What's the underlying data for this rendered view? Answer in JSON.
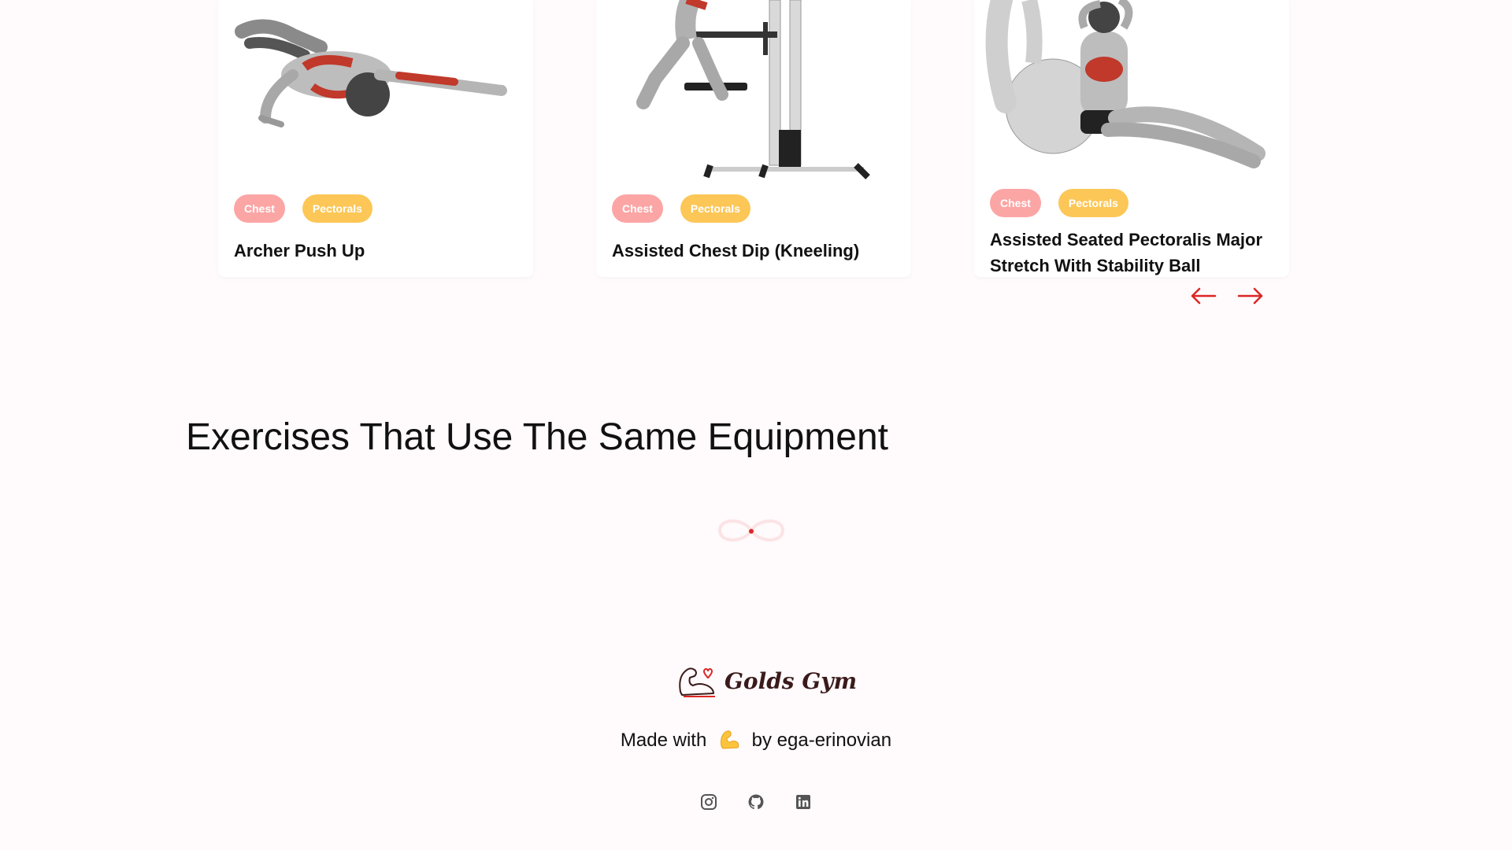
{
  "cards": [
    {
      "tags": [
        "Chest",
        "Pectorals"
      ],
      "title": "Archer Push Up",
      "image_icon": "archer-push-up-illustration"
    },
    {
      "tags": [
        "Chest",
        "Pectorals"
      ],
      "title": "Assisted Chest Dip (Kneeling)",
      "image_icon": "assisted-chest-dip-illustration"
    },
    {
      "tags": [
        "Chest",
        "Pectorals"
      ],
      "title": "Assisted Seated Pectoralis Major Stretch With Stability Ball",
      "image_icon": "pectoralis-stretch-illustration"
    }
  ],
  "navigation": {
    "prev_icon": "arrow-left-icon",
    "next_icon": "arrow-right-icon",
    "color": "#dc2626"
  },
  "section": {
    "title": "Exercises That Use The Same Equipment",
    "loader_icon": "infinity-loader-icon"
  },
  "footer": {
    "brand": "Golds Gym",
    "made_with_prefix": "Made with",
    "made_with_suffix": "by ega-erinovian",
    "emoji_icon": "flexed-biceps-emoji",
    "socials": [
      "instagram-icon",
      "github-icon",
      "linkedin-icon"
    ]
  },
  "colors": {
    "background": "#fffafb",
    "body_part_tag": "#fca5a5",
    "target_tag": "#fcc757",
    "accent": "#dc2626"
  }
}
